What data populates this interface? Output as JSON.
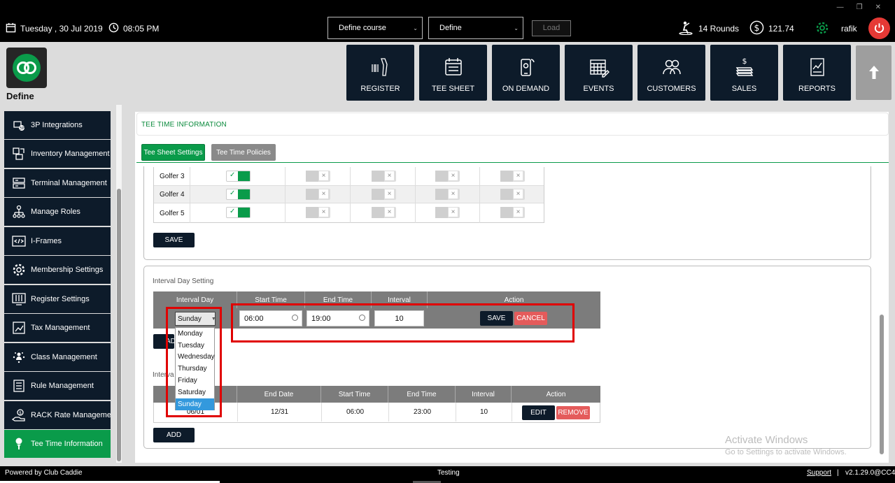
{
  "topbar": {
    "date": "Tuesday ,  30 Jul 2019",
    "time": "08:05 PM",
    "course_select": "Define course",
    "define_select": "Define",
    "load_label": "Load",
    "rounds": "14 Rounds",
    "balance": "121.74",
    "user": "rafik"
  },
  "brand": {
    "name": "Define"
  },
  "tiles": [
    {
      "label": "REGISTER",
      "icon": "scanner-icon"
    },
    {
      "label": "TEE SHEET",
      "icon": "calendar-icon"
    },
    {
      "label": "ON DEMAND",
      "icon": "mobile-icon"
    },
    {
      "label": "EVENTS",
      "icon": "events-calendar-icon"
    },
    {
      "label": "CUSTOMERS",
      "icon": "customers-icon"
    },
    {
      "label": "SALES",
      "icon": "sales-icon"
    },
    {
      "label": "REPORTS",
      "icon": "reports-icon"
    }
  ],
  "sidebar": {
    "items": [
      {
        "label": "3P Integrations",
        "icon": "integration-icon"
      },
      {
        "label": "Inventory Management",
        "icon": "inventory-icon"
      },
      {
        "label": "Terminal Management",
        "icon": "terminal-icon"
      },
      {
        "label": "Manage Roles",
        "icon": "roles-icon"
      },
      {
        "label": "I-Frames",
        "icon": "code-icon"
      },
      {
        "label": "Membership Settings",
        "icon": "gear-icon"
      },
      {
        "label": "Register Settings",
        "icon": "sliders-icon"
      },
      {
        "label": "Tax Management",
        "icon": "tax-icon"
      },
      {
        "label": "Class Management",
        "icon": "class-icon"
      },
      {
        "label": "Rule Management",
        "icon": "rules-icon"
      },
      {
        "label": "RACK Rate Manageme...",
        "icon": "rack-rate-icon"
      },
      {
        "label": "Tee Time Information",
        "icon": "golf-tee-icon"
      }
    ]
  },
  "main": {
    "section_title": "TEE TIME INFORMATION",
    "tabs": [
      {
        "label": "Tee Sheet Settings",
        "active": true
      },
      {
        "label": "Tee Time Policies",
        "active": false
      }
    ],
    "golfers": [
      {
        "name": "Golfer 3",
        "toggles": [
          true,
          false,
          false,
          false,
          false
        ]
      },
      {
        "name": "Golfer 4",
        "toggles": [
          true,
          false,
          false,
          false,
          false
        ]
      },
      {
        "name": "Golfer 5",
        "toggles": [
          true,
          false,
          false,
          false,
          false
        ]
      }
    ],
    "save_label": "SAVE",
    "interval_day": {
      "title": "Interval Day Setting",
      "headers": [
        "Interval Day",
        "Start Time",
        "End Time",
        "Interval",
        "Action"
      ],
      "selected_day": "Sunday",
      "start_time": "06:00",
      "end_time": "19:00",
      "interval": "10",
      "save_label": "SAVE",
      "cancel_label": "CANCEL",
      "add_label_partial": "AD",
      "options": [
        "Monday",
        "Tuesday",
        "Wednesday",
        "Thursday",
        "Friday",
        "Saturday",
        "Sunday"
      ]
    },
    "second_table": {
      "title_partial": "Interva",
      "headers": [
        "",
        "End Date",
        "Start Time",
        "End Time",
        "Interval",
        "Action"
      ],
      "row": {
        "start_date_partial": "06/01",
        "end_date": "12/31",
        "start_time": "06:00",
        "end_time": "23:00",
        "interval": "10"
      },
      "edit_label": "EDIT",
      "remove_label": "REMOVE",
      "add_label": "ADD"
    }
  },
  "watermark": {
    "line1": "Activate Windows",
    "line2": "Go to Settings to activate Windows."
  },
  "statusbar": {
    "powered_by": "Powered by Club Caddie",
    "env": "Testing",
    "support": "Support",
    "separator": "|",
    "version": "v2.1.29.0@CC4"
  },
  "colors": {
    "accent_green": "#0a9b4a",
    "navy": "#0d1b2a",
    "danger": "#e45b5b",
    "highlight": "#e00000"
  }
}
